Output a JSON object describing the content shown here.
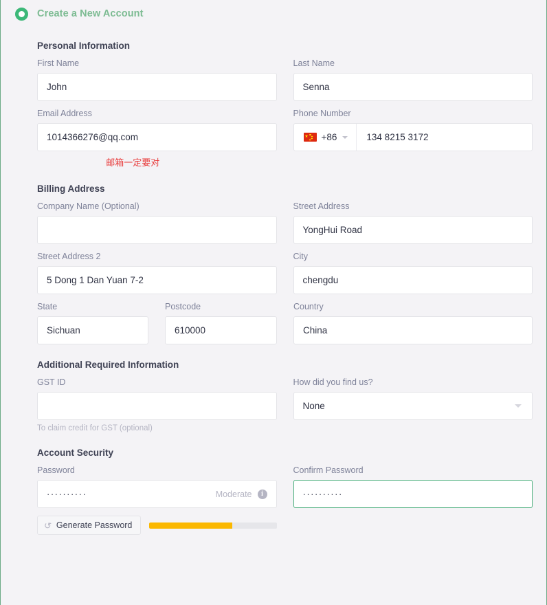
{
  "header": {
    "step_icon": "circle-step-icon",
    "title": "Create a New Account"
  },
  "sections": {
    "personal": {
      "title": "Personal Information",
      "first_name": {
        "label": "First Name",
        "value": "John",
        "placeholder": ""
      },
      "last_name": {
        "label": "Last Name",
        "value": "Senna",
        "placeholder": ""
      },
      "email": {
        "label": "Email Address",
        "value": "1014366276@qq.com",
        "placeholder": ""
      },
      "email_note": "邮箱一定要对",
      "phone": {
        "label": "Phone Number",
        "country_flag": "flag-cn-icon",
        "dial_code": "+86",
        "value": "134 8215 3172",
        "placeholder": ""
      }
    },
    "billing": {
      "title": "Billing Address",
      "company": {
        "label": "Company Name (Optional)",
        "value": "",
        "placeholder": ""
      },
      "street1": {
        "label": "Street Address",
        "value": "YongHui Road",
        "placeholder": ""
      },
      "street2": {
        "label": "Street Address 2",
        "value": "5 Dong 1 Dan Yuan 7-2",
        "placeholder": ""
      },
      "city": {
        "label": "City",
        "value": "chengdu",
        "placeholder": ""
      },
      "state": {
        "label": "State",
        "value": "Sichuan",
        "placeholder": ""
      },
      "postcode": {
        "label": "Postcode",
        "value": "610000",
        "placeholder": ""
      },
      "country": {
        "label": "Country",
        "value": "China",
        "placeholder": ""
      }
    },
    "additional": {
      "title": "Additional Required Information",
      "gst": {
        "label": "GST ID",
        "value": "",
        "placeholder": "",
        "helper": "To claim credit for GST (optional)"
      },
      "find_us": {
        "label": "How did you find us?",
        "selected": "None",
        "options": [
          "None"
        ]
      }
    },
    "security": {
      "title": "Account Security",
      "password": {
        "label": "Password",
        "value": "··········",
        "strength_label": "Moderate",
        "strength_percent": 65,
        "info_icon": "info-icon"
      },
      "confirm_password": {
        "label": "Confirm Password",
        "value": "··········",
        "state": "valid"
      },
      "generate_button": {
        "label": "Generate Password",
        "icon": "refresh-icon"
      }
    }
  },
  "colors": {
    "accent_green": "#3cb878",
    "title_green": "#7cbb92",
    "valid_border": "#4caf7d",
    "error_red": "#e83b3b",
    "strength_amber": "#fbb800",
    "page_bg": "#f4f3f6",
    "frame_border": "#6aa984"
  }
}
